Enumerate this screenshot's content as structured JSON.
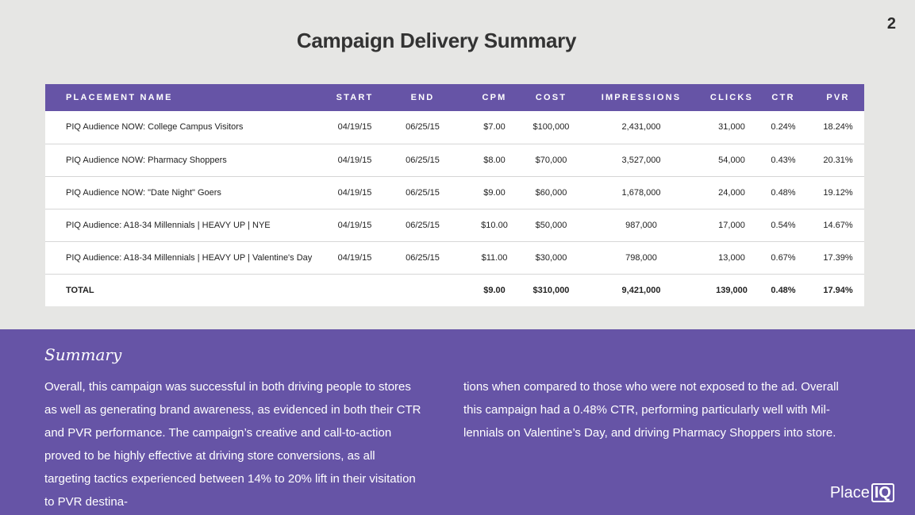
{
  "page_number": "2",
  "title": "Campaign Delivery Summary",
  "table": {
    "headers": [
      "PLACEMENT NAME",
      "START",
      "END",
      "CPM",
      "COST",
      "IMPRESSIONS",
      "CLICKS",
      "CTR",
      "PVR"
    ],
    "rows": [
      [
        "PIQ Audience NOW: College Campus Visitors",
        "04/19/15",
        "06/25/15",
        "$7.00",
        "$100,000",
        "2,431,000",
        "31,000",
        "0.24%",
        "18.24%"
      ],
      [
        "PIQ Audience NOW: Pharmacy Shoppers",
        "04/19/15",
        "06/25/15",
        "$8.00",
        "$70,000",
        "3,527,000",
        "54,000",
        "0.43%",
        "20.31%"
      ],
      [
        "PIQ Audience NOW: \"Date Night\" Goers",
        "04/19/15",
        "06/25/15",
        "$9.00",
        "$60,000",
        "1,678,000",
        "24,000",
        "0.48%",
        "19.12%"
      ],
      [
        "PIQ Audience: A18-34 Millennials | HEAVY UP | NYE",
        "04/19/15",
        "06/25/15",
        "$10.00",
        "$50,000",
        "987,000",
        "17,000",
        "0.54%",
        "14.67%"
      ],
      [
        "PIQ Audience: A18-34 Millennials | HEAVY UP | Valentine's Day",
        "04/19/15",
        "06/25/15",
        "$11.00",
        "$30,000",
        "798,000",
        "13,000",
        "0.67%",
        "17.39%"
      ]
    ],
    "total": [
      "TOTAL",
      "",
      "",
      "$9.00",
      "$310,000",
      "9,421,000",
      "139,000",
      "0.48%",
      "17.94%"
    ]
  },
  "summary": {
    "heading": "Summary",
    "left_text": "Overall, this campaign was successful in both driving people to stores as well as generating brand awareness, as evidenced in both their CTR and PVR performance. The campaign’s creative and call-to-action proved to be highly effective at driving store conversions, as all targeting tactics experienced between 14% to 20% lift in their visitation to PVR destina-",
    "right_text": "tions when compared to those who were not exposed to the ad. Overall this campaign had a 0.48% CTR, performing particularly well with Mil-lennials on Valentine’s Day, and driving Pharmacy Shoppers into store."
  },
  "logo": {
    "place": "Place",
    "iq": "IQ"
  },
  "colors": {
    "accent": "#6654a6",
    "background": "#e6e6e4"
  }
}
